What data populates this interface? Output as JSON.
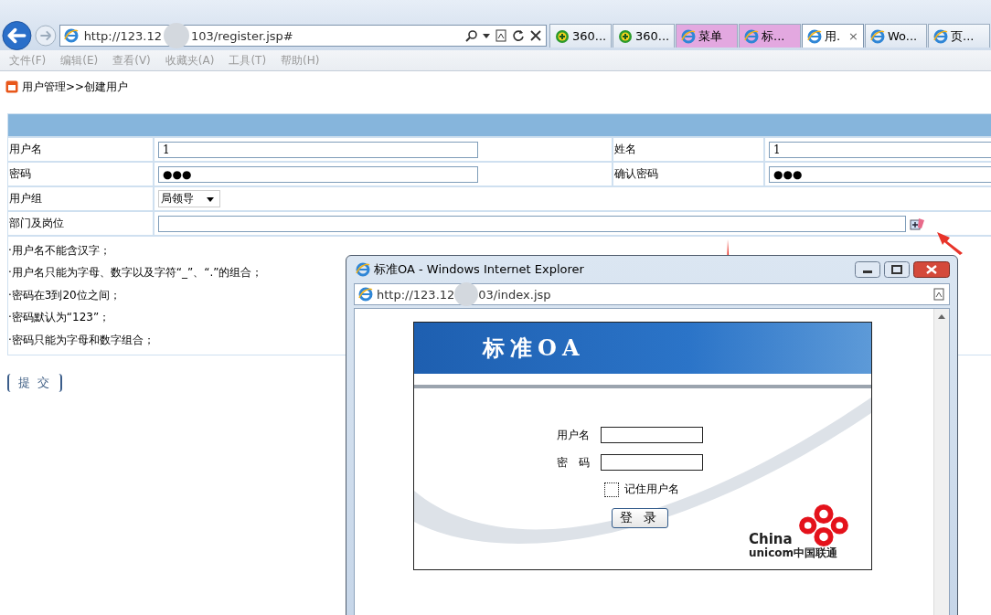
{
  "browser": {
    "url_start": "http://123.12",
    "url_end": "103/register.jsp#",
    "tabs": [
      {
        "kind": "addon",
        "label": "360...",
        "highlighted": false,
        "selected": false
      },
      {
        "kind": "addon",
        "label": "360...",
        "highlighted": false,
        "selected": false
      },
      {
        "kind": "ie",
        "label": "菜单",
        "highlighted": true,
        "selected": false
      },
      {
        "kind": "ie",
        "label": "标...",
        "highlighted": true,
        "selected": false
      },
      {
        "kind": "ie",
        "label": "用.",
        "highlighted": false,
        "selected": true,
        "close": "×"
      },
      {
        "kind": "ie",
        "label": "Wo...",
        "highlighted": false,
        "selected": false
      },
      {
        "kind": "ie",
        "label": "页...",
        "highlighted": false,
        "selected": false
      }
    ],
    "menu": [
      "文件(F)",
      "编辑(E)",
      "查看(V)",
      "收藏夹(A)",
      "工具(T)",
      "帮助(H)"
    ]
  },
  "breadcrumb": "用户管理>>创建用户",
  "form": {
    "rows": [
      {
        "kind": "pair",
        "label": "用户名",
        "value": "1",
        "label2": "姓名",
        "value2": "1"
      },
      {
        "kind": "pair",
        "label": "密码",
        "value": "●●●",
        "label2": "确认密码",
        "value2": "●●●"
      },
      {
        "kind": "select",
        "label": "用户组",
        "value": "局领导"
      },
      {
        "kind": "picker",
        "label": "部门及岗位"
      }
    ],
    "notes": [
      "·用户名不能含汉字；",
      "·用户名只能为字母、数字以及字符“_”、“.”的组合；",
      "·密码在3到20位之间；",
      "·密码默认为“123”；",
      "·密码只能为字母和数字组合；"
    ],
    "submit": "提 交"
  },
  "popup": {
    "title": "标准OA - Windows Internet Explorer",
    "url_start": "http://123.12",
    "url_end": "03/index.jsp",
    "login": {
      "banner": "标准OA",
      "username_label": "用户名",
      "password_label": "密　码",
      "remember": {
        "label": "记住用户名",
        "checked": false
      },
      "button": "登 录",
      "logo_line1": "China",
      "logo_line2": "unicom中国联通"
    }
  }
}
